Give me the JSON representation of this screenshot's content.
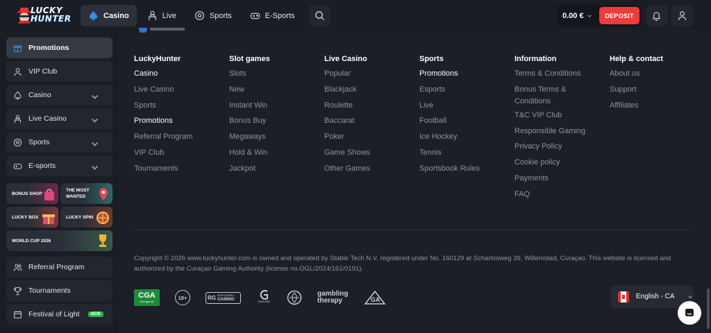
{
  "header": {
    "logo_line1": "LUCKY",
    "logo_line2": "HUNTER",
    "nav": [
      {
        "label": "Casino",
        "icon": "spade-icon"
      },
      {
        "label": "Live",
        "icon": "dealer-icon"
      },
      {
        "label": "Sports",
        "icon": "football-icon"
      },
      {
        "label": "E-Sports",
        "icon": "gamepad-icon"
      }
    ],
    "balance": "0.00 €",
    "deposit_label": "DEPOSIT"
  },
  "sidebar": {
    "items": [
      {
        "label": "Promotions"
      },
      {
        "label": "VIP Club"
      },
      {
        "label": "Casino"
      },
      {
        "label": "Live Casino"
      },
      {
        "label": "Sports"
      },
      {
        "label": "E-sports"
      }
    ],
    "tiles": [
      {
        "label": "BONUS SHOP"
      },
      {
        "label": "THE MOST WANTED"
      },
      {
        "label": "LUCKY BOX"
      },
      {
        "label": "LUCKY SPIN"
      },
      {
        "label": "WORLD CUP 2026"
      }
    ],
    "bottom_items": [
      {
        "label": "Referral Program"
      },
      {
        "label": "Tournaments"
      },
      {
        "label": "Festival of Light",
        "badge": "NEW"
      }
    ]
  },
  "footer": {
    "columns": [
      {
        "title": "LuckyHunter",
        "links": [
          "Casino",
          "Live Casino",
          "Sports",
          "Promotions",
          "Referral Program",
          "VIP Club",
          "Tournaments"
        ]
      },
      {
        "title": "Slot games",
        "links": [
          "Slots",
          "New",
          "Instant Win",
          "Bonus Buy",
          "Megaways",
          "Hold & Win",
          "Jackpot"
        ]
      },
      {
        "title": "Live Casino",
        "links": [
          "Popular",
          "Blackjack",
          "Roulette",
          "Baccarat",
          "Poker",
          "Game Shows",
          "Other Games"
        ]
      },
      {
        "title": "Sports",
        "links": [
          "Promotions",
          "Esports",
          "Live",
          "Football",
          "Ice Hockey",
          "Tennis",
          "Sportsbook Rules"
        ]
      },
      {
        "title": "Information",
        "links": [
          "Terms & Conditions",
          "Bonus Terms & Conditions",
          "T&C VIP Club",
          "Responsible Gaming",
          "Privacy Policy",
          "Cookie policy",
          "Payments",
          "FAQ"
        ]
      },
      {
        "title": "Help & contact",
        "links": [
          "About us",
          "Support",
          "Affiliates"
        ]
      }
    ],
    "copyright": "Copyright © 2026 www.luckyhunter.com is owned and operated by Stable Tech N.V. registered under No. 160129 at Scharlooweg 39, Willemstad, Curaçao. This website is licensed and authorized by the Curaçao Gaming Authority (license no.OGL/2024/161/0191).",
    "logos": {
      "cga": "CGA",
      "cga_sub": "cert.cga.cw",
      "age": "18+",
      "rg_mark": "RG",
      "rg_line1": "RESPONSIBLE",
      "rg_line2": "GAMING",
      "gamcare": "GAMCARE",
      "gt_line1": "gambling",
      "gt_line2": "therapy",
      "ga": "GA"
    },
    "language": "English - CA"
  },
  "colors": {
    "accent": "#ef3b3b",
    "bg": "#1c1f27",
    "sidebar": "#1a1d24"
  }
}
